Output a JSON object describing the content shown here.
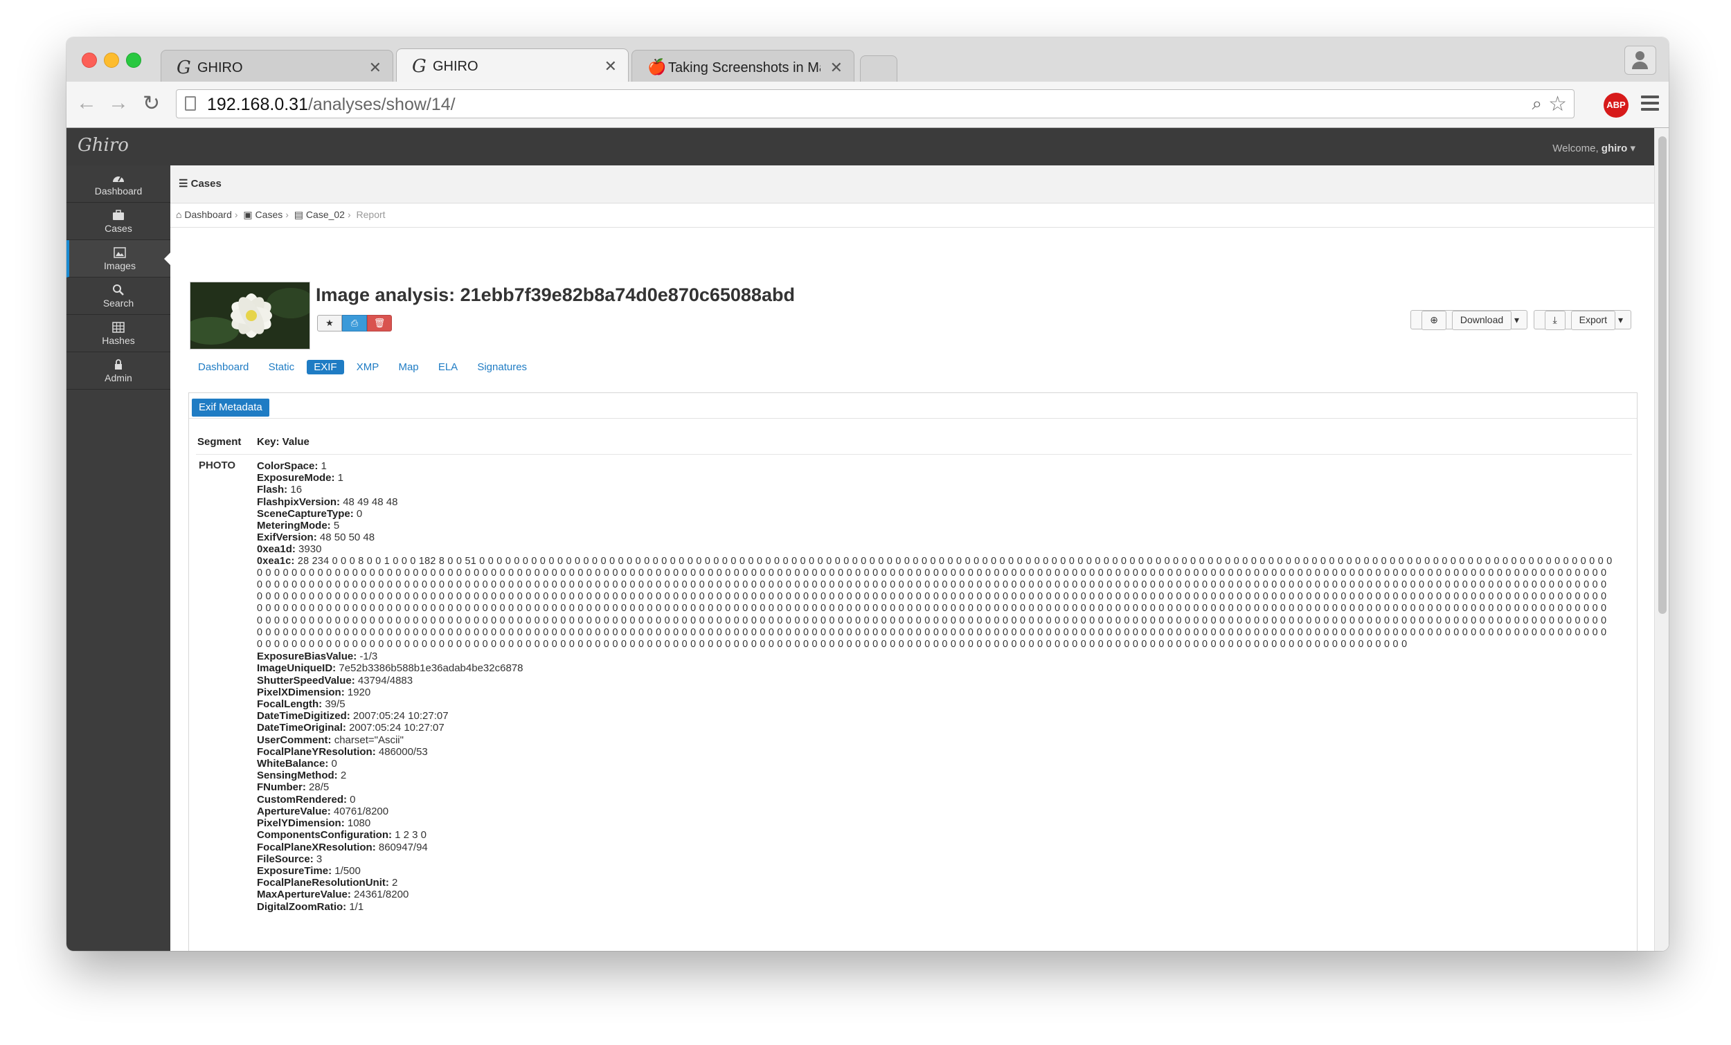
{
  "browser": {
    "tabs": [
      {
        "title": "GHIRO",
        "icon": "ghiro-icon"
      },
      {
        "title": "GHIRO",
        "icon": "ghiro-icon"
      },
      {
        "title": "Taking Screenshots in Mac",
        "icon": "apple-icon"
      }
    ],
    "url_host": "192.168.0.31",
    "url_path": "/analyses/show/14/",
    "abp_label": "ABP"
  },
  "app": {
    "brand": "Ghiro",
    "welcome_prefix": "Welcome, ",
    "welcome_user": "ghiro",
    "sidebar": [
      {
        "label": "Dashboard",
        "icon": "dashboard-icon"
      },
      {
        "label": "Cases",
        "icon": "briefcase-icon"
      },
      {
        "label": "Images",
        "icon": "image-icon",
        "active": true
      },
      {
        "label": "Search",
        "icon": "search-icon"
      },
      {
        "label": "Hashes",
        "icon": "grid-icon"
      },
      {
        "label": "Admin",
        "icon": "lock-icon"
      }
    ],
    "subheader": "Cases",
    "breadcrumb": [
      "Dashboard",
      "Cases",
      "Case_02",
      "Report"
    ],
    "title": "Image analysis: 21ebb7f39e82b8a74d0e870c65088abd",
    "actions": {
      "download": "Download",
      "export": "Export"
    },
    "tabs": [
      "Dashboard",
      "Static",
      "EXIF",
      "XMP",
      "Map",
      "ELA",
      "Signatures"
    ],
    "active_tab": "EXIF",
    "panel_title": "Exif Metadata",
    "columns": {
      "segment": "Segment",
      "keyvalue": "Key: Value"
    },
    "segment": "PHOTO",
    "exif_before": [
      {
        "k": "ColorSpace",
        "v": "1"
      },
      {
        "k": "ExposureMode",
        "v": "1"
      },
      {
        "k": "Flash",
        "v": "16"
      },
      {
        "k": "FlashpixVersion",
        "v": "48 49 48 48"
      },
      {
        "k": "SceneCaptureType",
        "v": "0"
      },
      {
        "k": "MeteringMode",
        "v": "5"
      },
      {
        "k": "ExifVersion",
        "v": "48 50 50 48"
      },
      {
        "k": "0xea1d",
        "v": "3930"
      }
    ],
    "exif_long": {
      "k": "0xea1c",
      "prefix": "28 234 0 0 0 8 0 0 1 0 0 0 182 8 0 0 51",
      "zero_count": 1200
    },
    "exif_after": [
      {
        "k": "ExposureBiasValue",
        "v": "-1/3"
      },
      {
        "k": "ImageUniqueID",
        "v": "7e52b3386b588b1e36adab4be32c6878"
      },
      {
        "k": "ShutterSpeedValue",
        "v": "43794/4883"
      },
      {
        "k": "PixelXDimension",
        "v": "1920"
      },
      {
        "k": "FocalLength",
        "v": "39/5"
      },
      {
        "k": "DateTimeDigitized",
        "v": "2007:05:24 10:27:07"
      },
      {
        "k": "DateTimeOriginal",
        "v": "2007:05:24 10:27:07"
      },
      {
        "k": "UserComment",
        "v": "charset=\"Ascii\""
      },
      {
        "k": "FocalPlaneYResolution",
        "v": "486000/53"
      },
      {
        "k": "WhiteBalance",
        "v": "0"
      },
      {
        "k": "SensingMethod",
        "v": "2"
      },
      {
        "k": "FNumber",
        "v": "28/5"
      },
      {
        "k": "CustomRendered",
        "v": "0"
      },
      {
        "k": "ApertureValue",
        "v": "40761/8200"
      },
      {
        "k": "PixelYDimension",
        "v": "1080"
      },
      {
        "k": "ComponentsConfiguration",
        "v": "1 2 3 0"
      },
      {
        "k": "FocalPlaneXResolution",
        "v": "860947/94"
      },
      {
        "k": "FileSource",
        "v": "3"
      },
      {
        "k": "ExposureTime",
        "v": "1/500"
      },
      {
        "k": "FocalPlaneResolutionUnit",
        "v": "2"
      },
      {
        "k": "MaxApertureValue",
        "v": "24361/8200"
      },
      {
        "k": "DigitalZoomRatio",
        "v": "1/1"
      }
    ]
  }
}
